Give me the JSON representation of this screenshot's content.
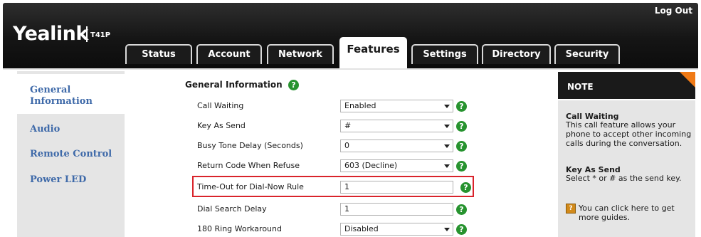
{
  "header": {
    "logo": "Yealink",
    "model": "T41P",
    "logout": "Log Out"
  },
  "tabs": [
    {
      "label": "Status"
    },
    {
      "label": "Account"
    },
    {
      "label": "Network"
    },
    {
      "label": "Features",
      "active": true
    },
    {
      "label": "Settings"
    },
    {
      "label": "Directory"
    },
    {
      "label": "Security"
    }
  ],
  "sidebar": {
    "items": [
      {
        "label_line1": "General",
        "label_line2": "Information",
        "active": true
      },
      {
        "label": "Audio"
      },
      {
        "label": "Remote Control"
      },
      {
        "label": "Power LED"
      }
    ]
  },
  "main": {
    "section_title": "General Information",
    "rows": [
      {
        "label": "Call Waiting",
        "value": "Enabled",
        "type": "select"
      },
      {
        "label": "Key As Send",
        "value": "#",
        "type": "select"
      },
      {
        "label": "Busy Tone Delay (Seconds)",
        "value": "0",
        "type": "select"
      },
      {
        "label": "Return Code When Refuse",
        "value": "603 (Decline)",
        "type": "select"
      },
      {
        "label": "Time-Out for Dial-Now Rule",
        "value": "1",
        "type": "input",
        "highlighted": true
      },
      {
        "label": "Dial Search Delay",
        "value": "1",
        "type": "input"
      },
      {
        "label": "180 Ring Workaround",
        "value": "Disabled",
        "type": "select"
      }
    ]
  },
  "note": {
    "title": "NOTE",
    "call_waiting_title": "Call Waiting",
    "call_waiting_text": "This call feature allows your phone to accept other incoming calls during the conversation.",
    "key_as_send_title": "Key As Send",
    "key_as_send_text": "Select * or # as the send key.",
    "guide_text": "You can click here to get more guides."
  },
  "colors": {
    "header_bg": "#151515",
    "sidebar_link": "#3f6aa9",
    "help_icon": "#27932f",
    "highlight_box": "#d9232b",
    "note_corner": "#f07a16"
  }
}
